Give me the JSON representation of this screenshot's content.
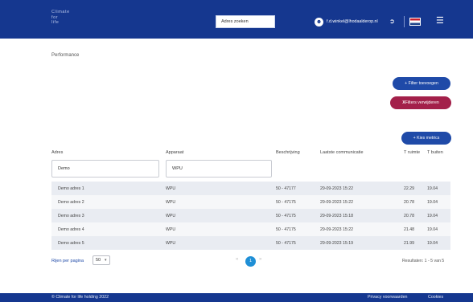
{
  "header": {
    "logo_lines": [
      "Climate",
      "for",
      "life"
    ],
    "search_placeholder": "Adres zoeken",
    "user_email": "f.d.winkel@lhodaalderop.nl",
    "icons": {
      "user": "user-icon",
      "logout": "logout-icon",
      "flag": "dutch-flag-icon",
      "menu": "hamburger-menu-icon"
    }
  },
  "page": {
    "title": "Performance"
  },
  "buttons": {
    "filter_add": "+ Filter toevoegen",
    "filters_remove": "Filters verwijderen",
    "filters_remove_icon": "X",
    "metrics": "+ Kies metrics"
  },
  "table": {
    "columns": [
      "Adres",
      "Apparaat",
      "Beschrijving",
      "Laatste communicatie",
      "T ruimte",
      "T buiten"
    ],
    "filters": {
      "adres": "Demo",
      "apparaat": "WPU"
    },
    "rows": [
      [
        "Demo adres 1",
        "WPU",
        "50 - 47177",
        "29-09-2023 15:22",
        "22.29",
        "19.04"
      ],
      [
        "Demo adres 2",
        "WPU",
        "50 - 47175",
        "29-09-2023 15:22",
        "20.78",
        "19.04"
      ],
      [
        "Demo adres 3",
        "WPU",
        "50 - 47175",
        "29-09-2023 15:18",
        "20.78",
        "19.04"
      ],
      [
        "Demo adres 4",
        "WPU",
        "50 - 47175",
        "29-09-2023 15:22",
        "21.48",
        "19.04"
      ],
      [
        "Demo adres 5",
        "WPU",
        "50 - 47175",
        "29-09-2023 15:19",
        "21.99",
        "19.04"
      ]
    ]
  },
  "pagination": {
    "per_page_label": "Rijen per pagina",
    "per_page_value": "50",
    "current_page": "1",
    "prev": "«",
    "next": "»",
    "results": "Resultaten: 1 - 5 van 5"
  },
  "footer": {
    "copyright": "© Climate for life holding 2022",
    "privacy": "Privacy voorwaarden",
    "cookies": "Cookies"
  },
  "colors": {
    "header": "#15378f",
    "primary_button": "#1f4aa8",
    "danger_button": "#a3204a",
    "page_active": "#1f8fd6"
  }
}
